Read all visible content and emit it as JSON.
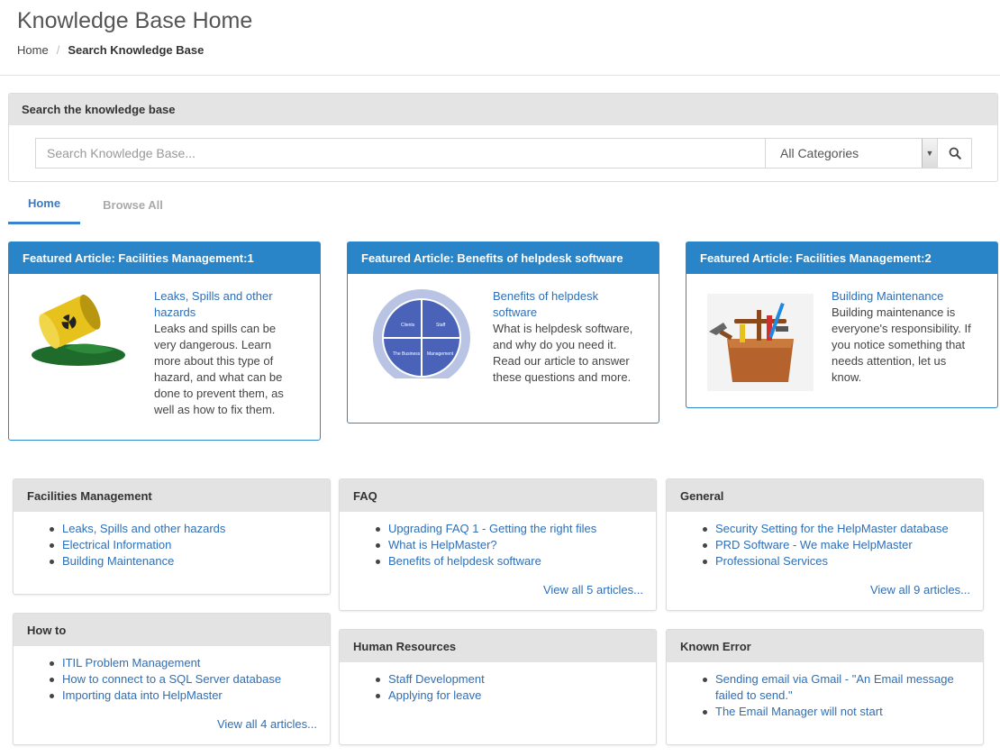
{
  "header": {
    "title": "Knowledge Base Home",
    "breadcrumb": {
      "home": "Home",
      "separator": "/",
      "current": "Search Knowledge Base"
    }
  },
  "search": {
    "panel_title": "Search the knowledge base",
    "placeholder": "Search Knowledge Base...",
    "category_value": "All Categories",
    "button_icon": "search-icon"
  },
  "tabs": {
    "home": "Home",
    "browse_all": "Browse All"
  },
  "featured": [
    {
      "header": "Featured Article: Facilities Management:1",
      "title": "Leaks, Spills and other hazards",
      "summary": "Leaks and spills can be very dangerous. Learn more about this type of hazard, and what can be done to prevent them, as well as how to fix them.",
      "image": "radioactive-barrel-spill"
    },
    {
      "header": "Featured Article: Benefits of helpdesk software",
      "title": "Benefits of helpdesk software",
      "summary": "What is helpdesk software, and why do you need it. Read our article to answer these questions and more.",
      "image": "cycle-diagram",
      "diagram_labels": [
        "Clients",
        "Staff",
        "The Business",
        "Management"
      ]
    },
    {
      "header": "Featured Article: Facilities Management:2",
      "title": "Building Maintenance",
      "summary": "Building maintenance is everyone's responsibility. If you notice something that needs attention, let us know.",
      "image": "toolbox"
    }
  ],
  "categories": [
    {
      "name": "Facilities Management",
      "items": [
        "Leaks, Spills and other hazards",
        "Electrical Information",
        "Building Maintenance"
      ],
      "view_all": ""
    },
    {
      "name": "FAQ",
      "items": [
        "Upgrading FAQ 1 - Getting the right files",
        "What is HelpMaster?",
        "Benefits of helpdesk software"
      ],
      "view_all": "View all 5 articles..."
    },
    {
      "name": "General",
      "items": [
        "Security Setting for the HelpMaster database",
        "PRD Software - We make HelpMaster",
        "Professional Services"
      ],
      "view_all": "View all 9 articles..."
    },
    {
      "name": "How to",
      "items": [
        "ITIL Problem Management",
        "How to connect to a SQL Server database",
        "Importing data into HelpMaster"
      ],
      "view_all": "View all 4 articles..."
    },
    {
      "name": "Human Resources",
      "items": [
        "Staff Development",
        "Applying for leave"
      ],
      "view_all": ""
    },
    {
      "name": "Known Error",
      "items": [
        "Sending email via Gmail - \"An Email message failed to send.\"",
        "The Email Manager will not start"
      ],
      "view_all": ""
    }
  ],
  "colors": {
    "accent": "#2a84c8",
    "link": "#2e6fb7",
    "panel_header": "#e3e3e3"
  }
}
